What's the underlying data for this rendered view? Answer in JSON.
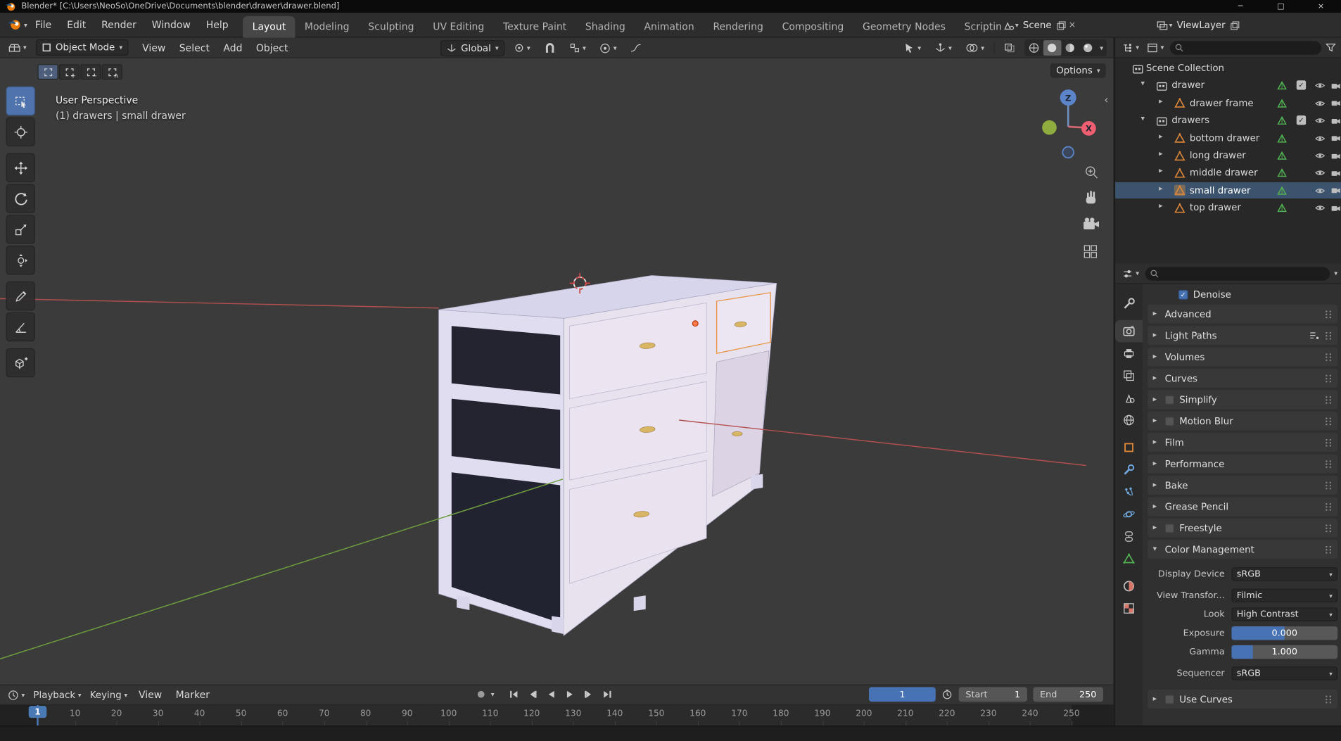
{
  "colors": {
    "accent": "#4772b3",
    "selection_orange": "#e8974a",
    "mesh_icon_orange": "#e0883a",
    "data_icon_green": "#52b152",
    "axis_x_red": "#b34f4f",
    "axis_y_green": "#6f9e3e",
    "viewport_bg": "#3b3b3b"
  },
  "icons": {
    "minimize": "─",
    "maximize": "□",
    "close": "×",
    "chevron": "▾",
    "expand_right": "▸",
    "expand_down": "▾",
    "plus": "+",
    "check": "✓",
    "collapse_left": "‹",
    "record_dot": "●"
  },
  "titlebar": {
    "title": "Blender* [C:\\Users\\NeoSo\\OneDrive\\Documents\\blender\\drawer\\drawer.blend]"
  },
  "topbar": {
    "menus": [
      "File",
      "Edit",
      "Render",
      "Window",
      "Help"
    ],
    "tabs": [
      "Layout",
      "Modeling",
      "Sculpting",
      "UV Editing",
      "Texture Paint",
      "Shading",
      "Animation",
      "Rendering",
      "Compositing",
      "Geometry Nodes",
      "Scripting"
    ],
    "active_tab": "Layout",
    "scene_label": "Scene",
    "view_layer_label": "ViewLayer"
  },
  "tool_header": {
    "mode": "Object Mode",
    "menus": [
      "View",
      "Select",
      "Add",
      "Object"
    ],
    "orientation": "Global",
    "options_label": "Options"
  },
  "viewport": {
    "overlay_line1": "User Perspective",
    "overlay_line2": "(1) drawers | small drawer",
    "gizmo_z": "Z",
    "gizmo_x": "X"
  },
  "toolbar": {
    "active_tool": "select-box",
    "tools": [
      "select-box",
      "cursor",
      "move",
      "rotate",
      "scale",
      "transform",
      "annotate",
      "measure",
      "add-cube"
    ]
  },
  "select_modes": [
    "set",
    "extend",
    "subtract",
    "intersect"
  ],
  "outliner": {
    "rows": [
      {
        "label": "Scene Collection",
        "level": 0,
        "type": "scene-collection",
        "expander": "",
        "selected": false,
        "checkbox": false,
        "eye": false,
        "camera": false,
        "data_icon": false
      },
      {
        "label": "drawer",
        "level": 1,
        "type": "collection",
        "expander": "down",
        "selected": false,
        "checkbox": true,
        "eye": true,
        "camera": true,
        "data_icon": true
      },
      {
        "label": "drawer frame",
        "level": 2,
        "type": "object",
        "expander": "right",
        "selected": false,
        "checkbox": false,
        "eye": true,
        "camera": true,
        "data_icon": true
      },
      {
        "label": "drawers",
        "level": 1,
        "type": "collection",
        "expander": "down",
        "selected": false,
        "checkbox": true,
        "eye": true,
        "camera": true,
        "data_icon": true
      },
      {
        "label": "bottom drawer",
        "level": 2,
        "type": "object",
        "expander": "right",
        "selected": false,
        "checkbox": false,
        "eye": true,
        "camera": true,
        "data_icon": true
      },
      {
        "label": "long drawer",
        "level": 2,
        "type": "object",
        "expander": "right",
        "selected": false,
        "checkbox": false,
        "eye": true,
        "camera": true,
        "data_icon": true
      },
      {
        "label": "middle drawer",
        "level": 2,
        "type": "object",
        "expander": "right",
        "selected": false,
        "checkbox": false,
        "eye": true,
        "camera": true,
        "data_icon": true
      },
      {
        "label": "small drawer",
        "level": 2,
        "type": "object",
        "expander": "right",
        "selected": true,
        "checkbox": false,
        "eye": true,
        "camera": true,
        "data_icon": true
      },
      {
        "label": "top drawer",
        "level": 2,
        "type": "object",
        "expander": "right",
        "selected": false,
        "checkbox": false,
        "eye": true,
        "camera": true,
        "data_icon": true
      }
    ]
  },
  "properties": {
    "tabs": [
      "tool",
      "render",
      "output",
      "view-layer",
      "scene",
      "world",
      "object",
      "modifiers",
      "particles",
      "physics",
      "constraints",
      "object-data",
      "material",
      "texture"
    ],
    "active_tab": "render",
    "sections": [
      {
        "label": "Denoise",
        "kind": "checkbox-row",
        "checked": true
      },
      {
        "label": "Advanced",
        "kind": "collapsed"
      },
      {
        "label": "Light Paths",
        "kind": "collapsed",
        "preset": true
      },
      {
        "label": "Volumes",
        "kind": "collapsed"
      },
      {
        "label": "Curves",
        "kind": "collapsed"
      },
      {
        "label": "Simplify",
        "kind": "collapsed",
        "checkbox": "unchecked"
      },
      {
        "label": "Motion Blur",
        "kind": "collapsed",
        "checkbox": "unchecked"
      },
      {
        "label": "Film",
        "kind": "collapsed"
      },
      {
        "label": "Performance",
        "kind": "collapsed"
      },
      {
        "label": "Bake",
        "kind": "collapsed"
      },
      {
        "label": "Grease Pencil",
        "kind": "collapsed"
      },
      {
        "label": "Freestyle",
        "kind": "collapsed",
        "checkbox": "unchecked"
      },
      {
        "label": "Color Management",
        "kind": "expanded"
      }
    ],
    "color_management": {
      "fields": [
        {
          "label": "Display Device",
          "value": "sRGB",
          "type": "dropdown"
        },
        {
          "label": "View Transfor...",
          "value": "Filmic",
          "type": "dropdown"
        },
        {
          "label": "Look",
          "value": "High Contrast",
          "type": "dropdown"
        },
        {
          "label": "Exposure",
          "value": "0.000",
          "type": "slider",
          "fill": 0.5
        },
        {
          "label": "Gamma",
          "value": "1.000",
          "type": "slider",
          "fill": 0.2
        },
        {
          "label": "Sequencer",
          "value": "sRGB",
          "type": "dropdown"
        }
      ],
      "use_curves_label": "Use Curves"
    }
  },
  "timeline": {
    "playback_label": "Playback",
    "keying_label": "Keying",
    "view_label": "View",
    "marker_label": "Marker",
    "current_frame": "1",
    "start_label": "Start",
    "start_value": "1",
    "end_label": "End",
    "end_value": "250",
    "ruler": [
      "10",
      "20",
      "30",
      "40",
      "50",
      "60",
      "70",
      "80",
      "90",
      "100",
      "110",
      "120",
      "130",
      "140",
      "150",
      "160",
      "170",
      "180",
      "190",
      "200",
      "210",
      "220",
      "230",
      "240",
      "250"
    ]
  }
}
